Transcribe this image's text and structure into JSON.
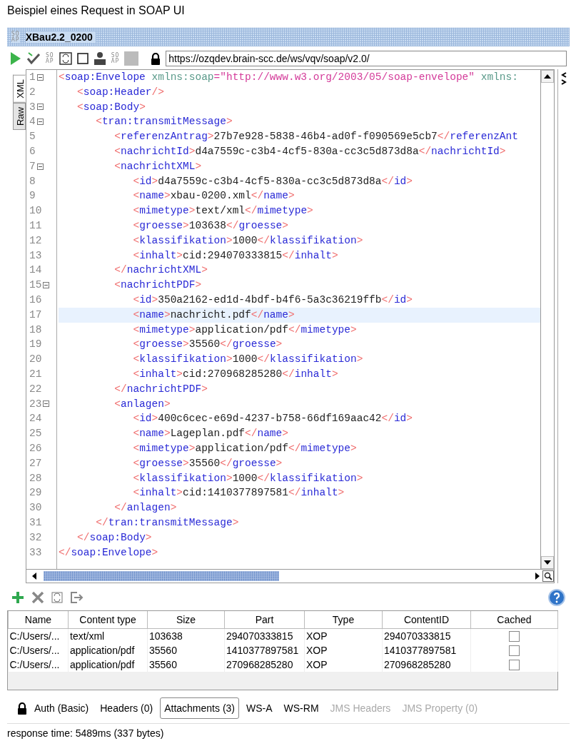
{
  "caption": "Beispiel eines Request in SOAP UI",
  "window": {
    "logo": [
      "SO",
      "AP"
    ],
    "title": "XBau2.2_0200"
  },
  "toolbar": [
    {
      "kind": "play"
    },
    {
      "kind": "run-check"
    },
    {
      "kind": "soap",
      "logo": [
        "SO",
        "AP"
      ]
    },
    {
      "kind": "frame"
    },
    {
      "kind": "square"
    },
    {
      "kind": "user"
    },
    {
      "kind": "soap",
      "logo": [
        "SO",
        "AP"
      ]
    },
    {
      "kind": "block"
    }
  ],
  "endpoint": {
    "value": "https://ozqdev.brain-scc.de/ws/vqv/soap/v2.0/"
  },
  "editor_tabs": [
    {
      "label": "XML",
      "selected": true
    },
    {
      "label": "Raw",
      "selected": false
    }
  ],
  "editor": {
    "lines": [
      {
        "num": "1",
        "fold": true,
        "highlighted": false,
        "code": [
          {
            "kind": "bracket",
            "text": "<"
          },
          {
            "kind": "tag",
            "text": "soap:Envelope"
          },
          {
            "kind": "attr",
            "text": " xmlns:soap"
          },
          {
            "kind": "value",
            "text": "=\"http://www.w3.org/2003/05/soap-envelope\""
          },
          {
            "kind": "attr",
            "text": " xmlns:"
          }
        ]
      },
      {
        "num": "2",
        "fold": false,
        "highlighted": false,
        "code": [
          {
            "kind": "bracket",
            "text": "   <"
          },
          {
            "kind": "tag",
            "text": "soap:Header"
          },
          {
            "kind": "bracket",
            "text": "/>"
          }
        ]
      },
      {
        "num": "3",
        "fold": true,
        "highlighted": false,
        "code": [
          {
            "kind": "bracket",
            "text": "   <"
          },
          {
            "kind": "tag",
            "text": "soap:Body"
          },
          {
            "kind": "bracket",
            "text": ">"
          }
        ]
      },
      {
        "num": "4",
        "fold": true,
        "highlighted": false,
        "code": [
          {
            "kind": "bracket",
            "text": "      <"
          },
          {
            "kind": "tag",
            "text": "tran:transmitMessage"
          },
          {
            "kind": "bracket",
            "text": ">"
          }
        ]
      },
      {
        "num": "5",
        "fold": false,
        "highlighted": false,
        "code": [
          {
            "kind": "bracket",
            "text": "         <"
          },
          {
            "kind": "tag",
            "text": "referenzAntrag"
          },
          {
            "kind": "bracket",
            "text": ">"
          },
          {
            "kind": "text",
            "text": "27b7e928-5838-46b4-ad0f-f090569e5cb7"
          },
          {
            "kind": "bracket",
            "text": "</"
          },
          {
            "kind": "tag",
            "text": "referenzAnt"
          }
        ]
      },
      {
        "num": "6",
        "fold": false,
        "highlighted": false,
        "code": [
          {
            "kind": "bracket",
            "text": "         <"
          },
          {
            "kind": "tag",
            "text": "nachrichtId"
          },
          {
            "kind": "bracket",
            "text": ">"
          },
          {
            "kind": "text",
            "text": "d4a7559c-c3b4-4cf5-830a-cc3c5d873d8a"
          },
          {
            "kind": "bracket",
            "text": "</"
          },
          {
            "kind": "tag",
            "text": "nachrichtId"
          },
          {
            "kind": "bracket",
            "text": ">"
          }
        ]
      },
      {
        "num": "7",
        "fold": true,
        "highlighted": false,
        "code": [
          {
            "kind": "bracket",
            "text": "         <"
          },
          {
            "kind": "tag",
            "text": "nachrichtXML"
          },
          {
            "kind": "bracket",
            "text": ">"
          }
        ]
      },
      {
        "num": "8",
        "fold": false,
        "highlighted": false,
        "code": [
          {
            "kind": "bracket",
            "text": "            <"
          },
          {
            "kind": "tag",
            "text": "id"
          },
          {
            "kind": "bracket",
            "text": ">"
          },
          {
            "kind": "text",
            "text": "d4a7559c-c3b4-4cf5-830a-cc3c5d873d8a"
          },
          {
            "kind": "bracket",
            "text": "</"
          },
          {
            "kind": "tag",
            "text": "id"
          },
          {
            "kind": "bracket",
            "text": ">"
          }
        ]
      },
      {
        "num": "9",
        "fold": false,
        "highlighted": false,
        "code": [
          {
            "kind": "bracket",
            "text": "            <"
          },
          {
            "kind": "tag",
            "text": "name"
          },
          {
            "kind": "bracket",
            "text": ">"
          },
          {
            "kind": "text",
            "text": "xbau-0200.xml"
          },
          {
            "kind": "bracket",
            "text": "</"
          },
          {
            "kind": "tag",
            "text": "name"
          },
          {
            "kind": "bracket",
            "text": ">"
          }
        ]
      },
      {
        "num": "10",
        "fold": false,
        "highlighted": false,
        "code": [
          {
            "kind": "bracket",
            "text": "            <"
          },
          {
            "kind": "tag",
            "text": "mimetype"
          },
          {
            "kind": "bracket",
            "text": ">"
          },
          {
            "kind": "text",
            "text": "text/xml"
          },
          {
            "kind": "bracket",
            "text": "</"
          },
          {
            "kind": "tag",
            "text": "mimetype"
          },
          {
            "kind": "bracket",
            "text": ">"
          }
        ]
      },
      {
        "num": "11",
        "fold": false,
        "highlighted": false,
        "code": [
          {
            "kind": "bracket",
            "text": "            <"
          },
          {
            "kind": "tag",
            "text": "groesse"
          },
          {
            "kind": "bracket",
            "text": ">"
          },
          {
            "kind": "text",
            "text": "103638"
          },
          {
            "kind": "bracket",
            "text": "</"
          },
          {
            "kind": "tag",
            "text": "groesse"
          },
          {
            "kind": "bracket",
            "text": ">"
          }
        ]
      },
      {
        "num": "12",
        "fold": false,
        "highlighted": false,
        "code": [
          {
            "kind": "bracket",
            "text": "            <"
          },
          {
            "kind": "tag",
            "text": "klassifikation"
          },
          {
            "kind": "bracket",
            "text": ">"
          },
          {
            "kind": "text",
            "text": "1000"
          },
          {
            "kind": "bracket",
            "text": "</"
          },
          {
            "kind": "tag",
            "text": "klassifikation"
          },
          {
            "kind": "bracket",
            "text": ">"
          }
        ]
      },
      {
        "num": "13",
        "fold": false,
        "highlighted": false,
        "code": [
          {
            "kind": "bracket",
            "text": "            <"
          },
          {
            "kind": "tag",
            "text": "inhalt"
          },
          {
            "kind": "bracket",
            "text": ">"
          },
          {
            "kind": "text",
            "text": "cid:294070333815"
          },
          {
            "kind": "bracket",
            "text": "</"
          },
          {
            "kind": "tag",
            "text": "inhalt"
          },
          {
            "kind": "bracket",
            "text": ">"
          }
        ]
      },
      {
        "num": "14",
        "fold": false,
        "highlighted": false,
        "code": [
          {
            "kind": "bracket",
            "text": "         </"
          },
          {
            "kind": "tag",
            "text": "nachrichtXML"
          },
          {
            "kind": "bracket",
            "text": ">"
          }
        ]
      },
      {
        "num": "15",
        "fold": true,
        "highlighted": false,
        "code": [
          {
            "kind": "bracket",
            "text": "         <"
          },
          {
            "kind": "tag",
            "text": "nachrichtPDF"
          },
          {
            "kind": "bracket",
            "text": ">"
          }
        ]
      },
      {
        "num": "16",
        "fold": false,
        "highlighted": false,
        "code": [
          {
            "kind": "bracket",
            "text": "            <"
          },
          {
            "kind": "tag",
            "text": "id"
          },
          {
            "kind": "bracket",
            "text": ">"
          },
          {
            "kind": "text",
            "text": "350a2162-ed1d-4bdf-b4f6-5a3c36219ffb"
          },
          {
            "kind": "bracket",
            "text": "</"
          },
          {
            "kind": "tag",
            "text": "id"
          },
          {
            "kind": "bracket",
            "text": ">"
          }
        ]
      },
      {
        "num": "17",
        "fold": false,
        "highlighted": true,
        "code": [
          {
            "kind": "bracket",
            "text": "            <"
          },
          {
            "kind": "tag",
            "text": "name"
          },
          {
            "kind": "bracket",
            "text": ">"
          },
          {
            "kind": "text",
            "text": "nachricht.pdf"
          },
          {
            "kind": "bracket",
            "text": "</"
          },
          {
            "kind": "tag",
            "text": "name"
          },
          {
            "kind": "bracket",
            "text": ">"
          }
        ]
      },
      {
        "num": "18",
        "fold": false,
        "highlighted": false,
        "code": [
          {
            "kind": "bracket",
            "text": "            <"
          },
          {
            "kind": "tag",
            "text": "mimetype"
          },
          {
            "kind": "bracket",
            "text": ">"
          },
          {
            "kind": "text",
            "text": "application/pdf"
          },
          {
            "kind": "bracket",
            "text": "</"
          },
          {
            "kind": "tag",
            "text": "mimetype"
          },
          {
            "kind": "bracket",
            "text": ">"
          }
        ]
      },
      {
        "num": "19",
        "fold": false,
        "highlighted": false,
        "code": [
          {
            "kind": "bracket",
            "text": "            <"
          },
          {
            "kind": "tag",
            "text": "groesse"
          },
          {
            "kind": "bracket",
            "text": ">"
          },
          {
            "kind": "text",
            "text": "35560"
          },
          {
            "kind": "bracket",
            "text": "</"
          },
          {
            "kind": "tag",
            "text": "groesse"
          },
          {
            "kind": "bracket",
            "text": ">"
          }
        ]
      },
      {
        "num": "20",
        "fold": false,
        "highlighted": false,
        "code": [
          {
            "kind": "bracket",
            "text": "            <"
          },
          {
            "kind": "tag",
            "text": "klassifikation"
          },
          {
            "kind": "bracket",
            "text": ">"
          },
          {
            "kind": "text",
            "text": "1000"
          },
          {
            "kind": "bracket",
            "text": "</"
          },
          {
            "kind": "tag",
            "text": "klassifikation"
          },
          {
            "kind": "bracket",
            "text": ">"
          }
        ]
      },
      {
        "num": "21",
        "fold": false,
        "highlighted": false,
        "code": [
          {
            "kind": "bracket",
            "text": "            <"
          },
          {
            "kind": "tag",
            "text": "inhalt"
          },
          {
            "kind": "bracket",
            "text": ">"
          },
          {
            "kind": "text",
            "text": "cid:270968285280"
          },
          {
            "kind": "bracket",
            "text": "</"
          },
          {
            "kind": "tag",
            "text": "inhalt"
          },
          {
            "kind": "bracket",
            "text": ">"
          }
        ]
      },
      {
        "num": "22",
        "fold": false,
        "highlighted": false,
        "code": [
          {
            "kind": "bracket",
            "text": "         </"
          },
          {
            "kind": "tag",
            "text": "nachrichtPDF"
          },
          {
            "kind": "bracket",
            "text": ">"
          }
        ]
      },
      {
        "num": "23",
        "fold": true,
        "highlighted": false,
        "code": [
          {
            "kind": "bracket",
            "text": "         <"
          },
          {
            "kind": "tag",
            "text": "anlagen"
          },
          {
            "kind": "bracket",
            "text": ">"
          }
        ]
      },
      {
        "num": "24",
        "fold": false,
        "highlighted": false,
        "code": [
          {
            "kind": "bracket",
            "text": "            <"
          },
          {
            "kind": "tag",
            "text": "id"
          },
          {
            "kind": "bracket",
            "text": ">"
          },
          {
            "kind": "text",
            "text": "400c6cec-e69d-4237-b758-66df169aac42"
          },
          {
            "kind": "bracket",
            "text": "</"
          },
          {
            "kind": "tag",
            "text": "id"
          },
          {
            "kind": "bracket",
            "text": ">"
          }
        ]
      },
      {
        "num": "25",
        "fold": false,
        "highlighted": false,
        "code": [
          {
            "kind": "bracket",
            "text": "            <"
          },
          {
            "kind": "tag",
            "text": "name"
          },
          {
            "kind": "bracket",
            "text": ">"
          },
          {
            "kind": "text",
            "text": "Lageplan.pdf"
          },
          {
            "kind": "bracket",
            "text": "</"
          },
          {
            "kind": "tag",
            "text": "name"
          },
          {
            "kind": "bracket",
            "text": ">"
          }
        ]
      },
      {
        "num": "26",
        "fold": false,
        "highlighted": false,
        "code": [
          {
            "kind": "bracket",
            "text": "            <"
          },
          {
            "kind": "tag",
            "text": "mimetype"
          },
          {
            "kind": "bracket",
            "text": ">"
          },
          {
            "kind": "text",
            "text": "application/pdf"
          },
          {
            "kind": "bracket",
            "text": "</"
          },
          {
            "kind": "tag",
            "text": "mimetype"
          },
          {
            "kind": "bracket",
            "text": ">"
          }
        ]
      },
      {
        "num": "27",
        "fold": false,
        "highlighted": false,
        "code": [
          {
            "kind": "bracket",
            "text": "            <"
          },
          {
            "kind": "tag",
            "text": "groesse"
          },
          {
            "kind": "bracket",
            "text": ">"
          },
          {
            "kind": "text",
            "text": "35560"
          },
          {
            "kind": "bracket",
            "text": "</"
          },
          {
            "kind": "tag",
            "text": "groesse"
          },
          {
            "kind": "bracket",
            "text": ">"
          }
        ]
      },
      {
        "num": "28",
        "fold": false,
        "highlighted": false,
        "code": [
          {
            "kind": "bracket",
            "text": "            <"
          },
          {
            "kind": "tag",
            "text": "klassifikation"
          },
          {
            "kind": "bracket",
            "text": ">"
          },
          {
            "kind": "text",
            "text": "1000"
          },
          {
            "kind": "bracket",
            "text": "</"
          },
          {
            "kind": "tag",
            "text": "klassifikation"
          },
          {
            "kind": "bracket",
            "text": ">"
          }
        ]
      },
      {
        "num": "29",
        "fold": false,
        "highlighted": false,
        "code": [
          {
            "kind": "bracket",
            "text": "            <"
          },
          {
            "kind": "tag",
            "text": "inhalt"
          },
          {
            "kind": "bracket",
            "text": ">"
          },
          {
            "kind": "text",
            "text": "cid:1410377897581"
          },
          {
            "kind": "bracket",
            "text": "</"
          },
          {
            "kind": "tag",
            "text": "inhalt"
          },
          {
            "kind": "bracket",
            "text": ">"
          }
        ]
      },
      {
        "num": "30",
        "fold": false,
        "highlighted": false,
        "code": [
          {
            "kind": "bracket",
            "text": "         </"
          },
          {
            "kind": "tag",
            "text": "anlagen"
          },
          {
            "kind": "bracket",
            "text": ">"
          }
        ]
      },
      {
        "num": "31",
        "fold": false,
        "highlighted": false,
        "code": [
          {
            "kind": "bracket",
            "text": "      </"
          },
          {
            "kind": "tag",
            "text": "tran:transmitMessage"
          },
          {
            "kind": "bracket",
            "text": ">"
          }
        ]
      },
      {
        "num": "32",
        "fold": false,
        "highlighted": false,
        "code": [
          {
            "kind": "bracket",
            "text": "   </"
          },
          {
            "kind": "tag",
            "text": "soap:Body"
          },
          {
            "kind": "bracket",
            "text": ">"
          }
        ]
      },
      {
        "num": "33",
        "fold": false,
        "highlighted": false,
        "code": [
          {
            "kind": "bracket",
            "text": "</"
          },
          {
            "kind": "tag",
            "text": "soap:Envelope"
          },
          {
            "kind": "bracket",
            "text": ">"
          }
        ]
      }
    ]
  },
  "attachments": {
    "columns": [
      "Name",
      "Content type",
      "Size",
      "Part",
      "Type",
      "ContentID",
      "Cached"
    ],
    "rows": [
      {
        "name": "C:/Users/...",
        "content_type": "text/xml",
        "size": "103638",
        "part": "294070333815",
        "type": "XOP",
        "content_id": "294070333815",
        "cached": false
      },
      {
        "name": "C:/Users/...",
        "content_type": "application/pdf",
        "size": "35560",
        "part": "1410377897581",
        "type": "XOP",
        "content_id": "1410377897581",
        "cached": false
      },
      {
        "name": "C:/Users/...",
        "content_type": "application/pdf",
        "size": "35560",
        "part": "270968285280",
        "type": "XOP",
        "content_id": "270968285280",
        "cached": false
      }
    ]
  },
  "bottom_tabs": [
    {
      "label": "Auth (Basic)",
      "kind": "lock",
      "selected": false,
      "disabled": false
    },
    {
      "label": "Headers (0)",
      "kind": "plain",
      "selected": false,
      "disabled": false
    },
    {
      "label": "Attachments (3)",
      "kind": "plain",
      "selected": true,
      "disabled": false
    },
    {
      "label": "WS-A",
      "kind": "plain",
      "selected": false,
      "disabled": false
    },
    {
      "label": "WS-RM",
      "kind": "plain",
      "selected": false,
      "disabled": false
    },
    {
      "label": "JMS Headers",
      "kind": "plain",
      "selected": false,
      "disabled": true
    },
    {
      "label": "JMS Property (0)",
      "kind": "plain",
      "selected": false,
      "disabled": true
    }
  ],
  "status_bar": "response time: 5489ms (337 bytes)"
}
